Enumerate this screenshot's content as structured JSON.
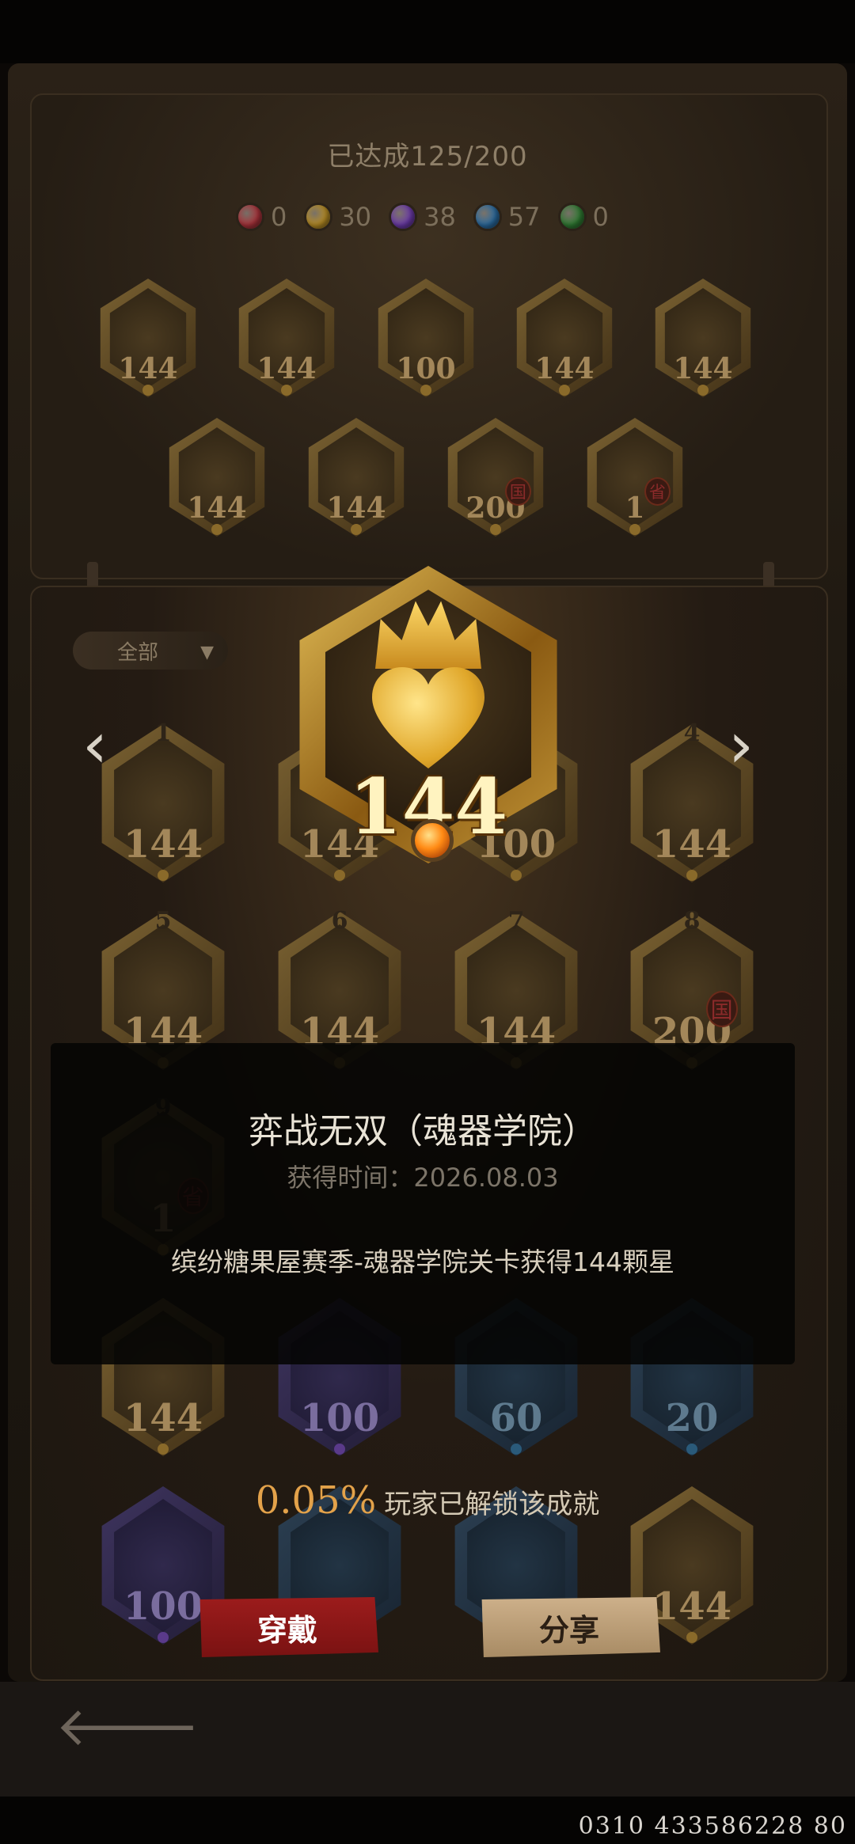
{
  "progress": {
    "label": "已达成125/200"
  },
  "gems": [
    {
      "name": "red-gem-icon",
      "color": "#a8323a",
      "count": "0"
    },
    {
      "name": "gold-gem-icon",
      "color": "#b58b24",
      "count": "30"
    },
    {
      "name": "purple-gem-icon",
      "color": "#6b3aa8",
      "count": "38"
    },
    {
      "name": "blue-gem-icon",
      "color": "#2a6a9e",
      "count": "57"
    },
    {
      "name": "green-gem-icon",
      "color": "#2f7a32",
      "count": "0"
    }
  ],
  "showcase_row1": [
    {
      "icon": "lion-icon",
      "value": "144"
    },
    {
      "icon": "flame-icon",
      "value": "144"
    },
    {
      "icon": "crown-icon",
      "value": "100"
    },
    {
      "icon": "dragon-icon",
      "value": "144"
    },
    {
      "icon": "gourd-icon",
      "value": "144"
    }
  ],
  "showcase_row2": [
    {
      "icon": "record-icon",
      "value": "144"
    },
    {
      "icon": "flame-icon",
      "value": "144"
    },
    {
      "icon": "shield-icon",
      "value": "200",
      "tag": "国"
    },
    {
      "icon": "winged-crest-icon",
      "value": "1",
      "tag": "省"
    }
  ],
  "filter": {
    "label": "全部"
  },
  "grid": [
    {
      "index": "1",
      "value": "144"
    },
    {
      "index": "",
      "value": "144"
    },
    {
      "index": "",
      "value": "100"
    },
    {
      "index": "4",
      "value": "144"
    },
    {
      "index": "5",
      "value": "144"
    },
    {
      "index": "6",
      "value": "144"
    },
    {
      "index": "7",
      "value": "144"
    },
    {
      "index": "8",
      "value": "200",
      "tag": "国"
    }
  ],
  "grid_row_hidden": [
    {
      "index": "9",
      "value": "1",
      "tag": "省"
    }
  ],
  "grid_row4": [
    {
      "value": "144",
      "tone": "gold"
    },
    {
      "value": "100",
      "tone": "purple"
    },
    {
      "value": "60",
      "tone": "blue"
    },
    {
      "value": "20",
      "tone": "blue"
    }
  ],
  "grid_row5": [
    {
      "value": "100",
      "tone": "purple"
    },
    {
      "value": "",
      "tone": "blue"
    },
    {
      "value": "",
      "tone": "blue"
    },
    {
      "value": "144",
      "tone": "gold"
    }
  ],
  "selected": {
    "value": "144"
  },
  "detail": {
    "title": "弈战无双（魂器学院）",
    "time": "获得时间：2026.08.03",
    "description": "缤纷糖果屋赛季-魂器学院关卡获得144颗星"
  },
  "unlock": {
    "percent": "0.05%",
    "text": "玩家已解锁该成就"
  },
  "buttons": {
    "wear": "穿戴",
    "share": "分享"
  },
  "footer": {
    "id": "0310 433586228 80"
  }
}
